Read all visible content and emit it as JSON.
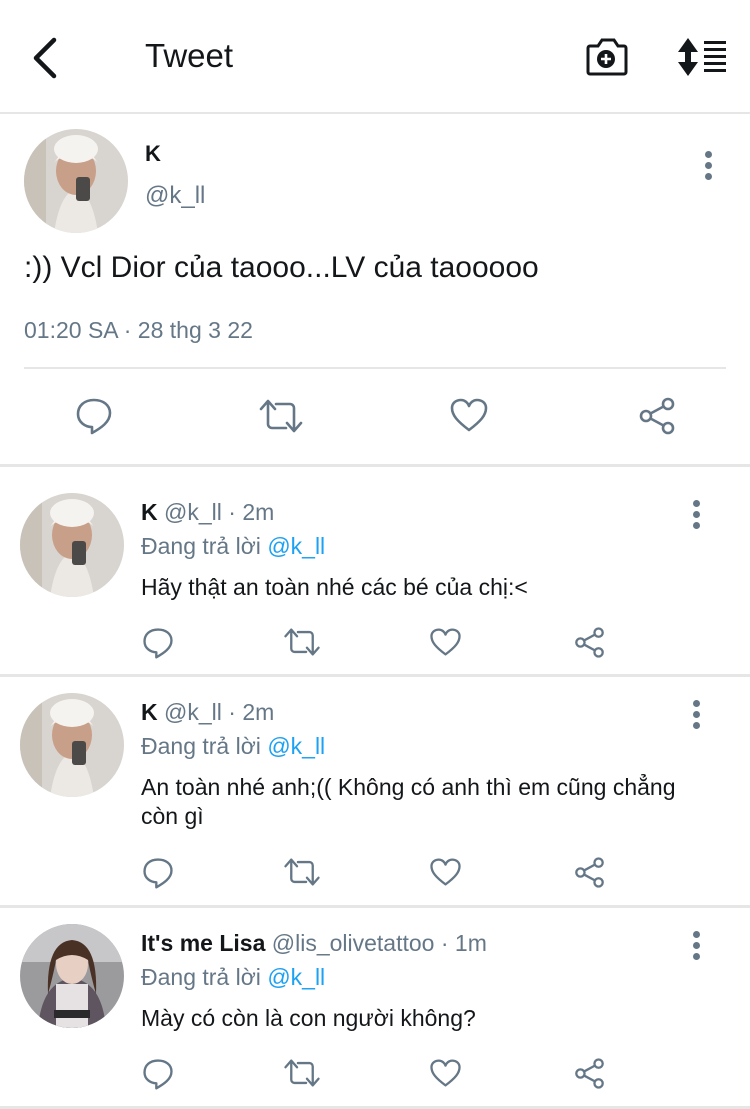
{
  "header": {
    "title": "Tweet"
  },
  "tweet": {
    "name": "K",
    "handle": "@k_ll",
    "text": ":)) Vcl Dior của taooo...LV của taooooo",
    "timestamp": "01:20 SA · 28 thg 3 22"
  },
  "replies": [
    {
      "name": "K",
      "handle": "@k_ll",
      "time": " · 2m",
      "replying_prefix": "Đang trả lời ",
      "replying_to": "@k_ll",
      "text": "Hãy thật an toàn nhé các bé của chị:<"
    },
    {
      "name": "K",
      "handle": "@k_ll",
      "time": " · 2m",
      "replying_prefix": "Đang trả lời ",
      "replying_to": "@k_ll",
      "text": "An toàn nhé anh;(( Không có anh thì em cũng chẳng còn gì"
    },
    {
      "name": "It's me Lisa",
      "handle": "@lis_olivetattoo",
      "time": " · 1m",
      "replying_prefix": "Đang trả lời ",
      "replying_to": "@k_ll",
      "text": "Mày có còn là con người không?"
    }
  ],
  "icons": {
    "back": "chevron-left-icon",
    "camera": "camera-plus-icon",
    "sort": "sort-icon",
    "reply": "comment-icon",
    "retweet": "retweet-icon",
    "like": "heart-icon",
    "share": "share-icon",
    "more": "more-vertical-icon"
  },
  "colors": {
    "accent": "#1da1f2",
    "secondary": "#657786",
    "icon": "#657786",
    "text": "#14171a"
  }
}
